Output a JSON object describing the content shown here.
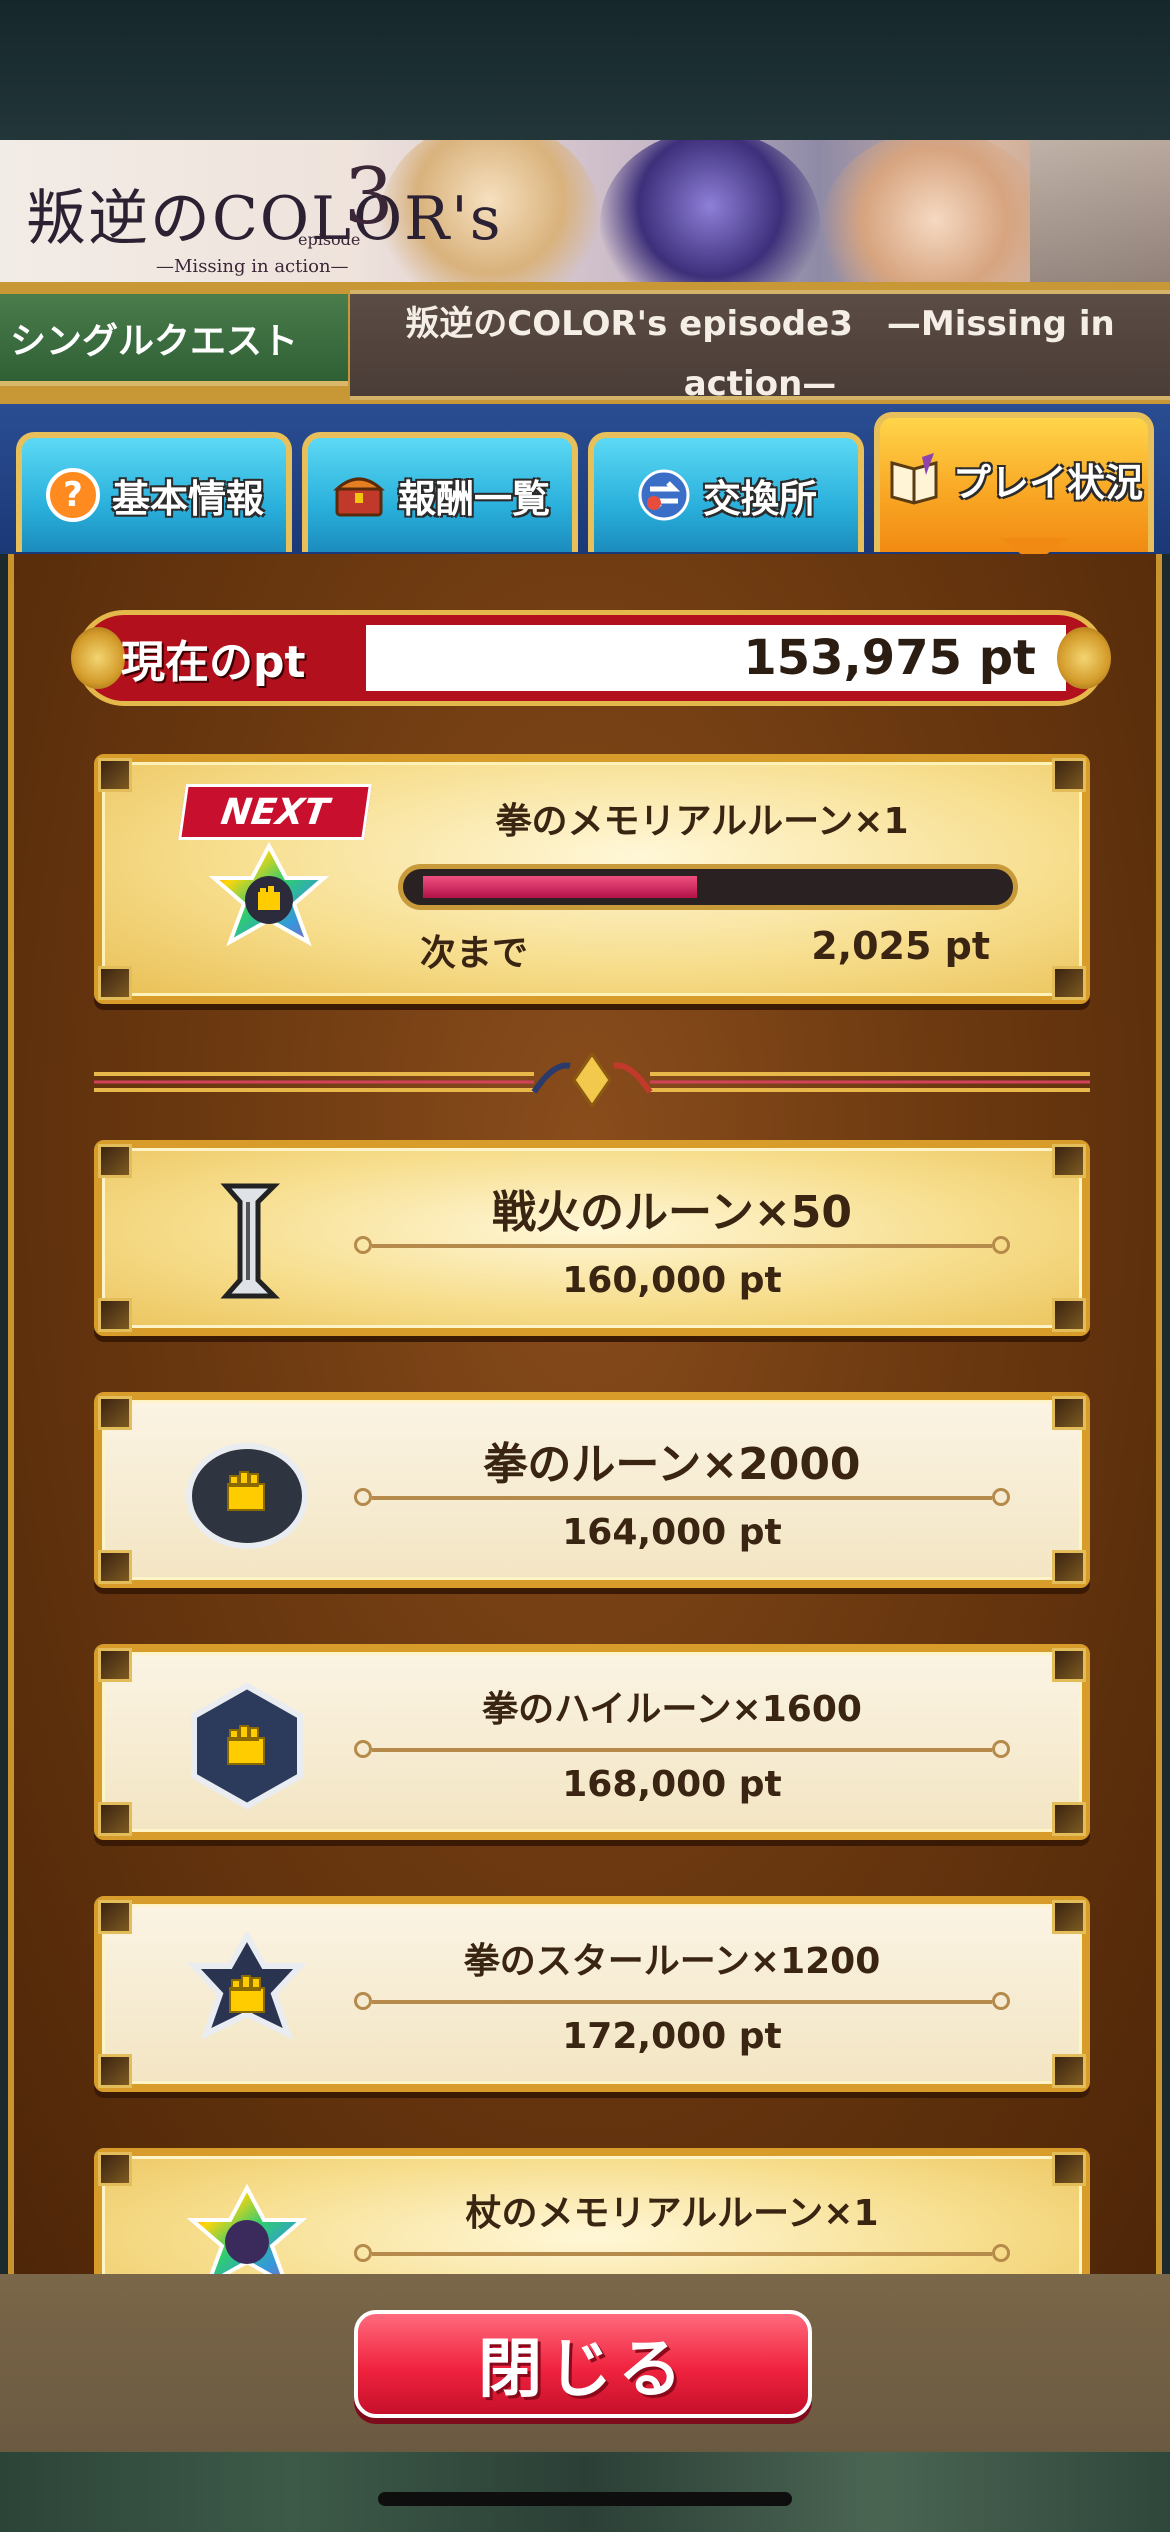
{
  "banner": {
    "logo_main": "叛逆のCOLOR's",
    "logo_number": "3",
    "logo_episode": "episode",
    "logo_subtitle": "—Missing in action—"
  },
  "header": {
    "quest_label": "シングルクエスト",
    "event_name": "叛逆のCOLOR's episode3　—Missing in action—"
  },
  "tabs": [
    {
      "label": "基本情報",
      "icon": "question-icon",
      "active": false
    },
    {
      "label": "報酬一覧",
      "icon": "treasure-chest-icon",
      "active": false
    },
    {
      "label": "交換所",
      "icon": "exchange-icon",
      "active": false
    },
    {
      "label": "プレイ状況",
      "icon": "book-icon",
      "active": true
    }
  ],
  "points": {
    "label": "現在のpt",
    "value": "153,975 pt"
  },
  "next_reward": {
    "badge": "NEXT",
    "name": "拳のメモリアルルーン×1",
    "progress_label": "次まで",
    "remaining": "2,025 pt",
    "progress_fraction": 0.48,
    "icon": "rainbow-fist-star-icon"
  },
  "rewards": [
    {
      "name": "戦火のルーン×50",
      "points": "160,000 pt",
      "icon": "war-rune-icon",
      "featured": true
    },
    {
      "name": "拳のルーン×2000",
      "points": "164,000 pt",
      "icon": "fist-rune-icon",
      "featured": false
    },
    {
      "name": "拳のハイルーン×1600",
      "points": "168,000 pt",
      "icon": "fist-high-rune-icon",
      "featured": false
    },
    {
      "name": "拳のスタールーン×1200",
      "points": "172,000 pt",
      "icon": "fist-star-rune-icon",
      "featured": false
    },
    {
      "name": "杖のメモリアルルーン×1",
      "points": "",
      "icon": "staff-memorial-rune-icon",
      "featured": true
    }
  ],
  "footer": {
    "close_label": "閉じる"
  },
  "colors": {
    "accent_gold": "#d79c2a",
    "points_red": "#b3101d",
    "progress_pink": "#d81b60",
    "close_red": "#f0233f",
    "active_tab_orange": "#f9a825",
    "tab_blue": "#2ab0dc"
  }
}
